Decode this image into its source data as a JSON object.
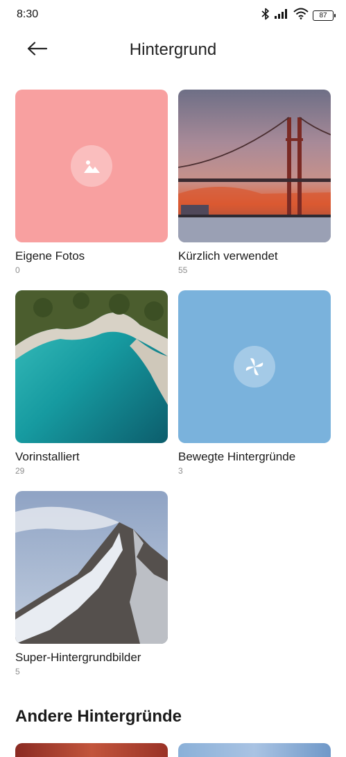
{
  "status_bar": {
    "time": "8:30",
    "battery": "87",
    "icons": [
      "bluetooth-icon",
      "signal-icon",
      "wifi-icon",
      "battery-icon"
    ]
  },
  "header": {
    "title": "Hintergrund",
    "back_icon": "arrow-left-icon"
  },
  "albums": [
    {
      "label": "Eigene Fotos",
      "count": "0",
      "color": "#f8a0a0",
      "icon": "image-icon"
    },
    {
      "label": "Kürzlich verwendet",
      "count": "55"
    },
    {
      "label": "Vorinstalliert",
      "count": "29"
    },
    {
      "label": "Bewegte Hintergründe",
      "count": "3",
      "color": "#7ab2dc",
      "icon": "pinwheel-icon"
    },
    {
      "label": "Super-Hintergrundbilder",
      "count": "5"
    }
  ],
  "section": {
    "title": "Andere Hintergründe"
  },
  "colors": {
    "accent_pink": "#f8a0a0",
    "accent_blue": "#7ab2dc",
    "count_gray": "#8c8c8c"
  }
}
